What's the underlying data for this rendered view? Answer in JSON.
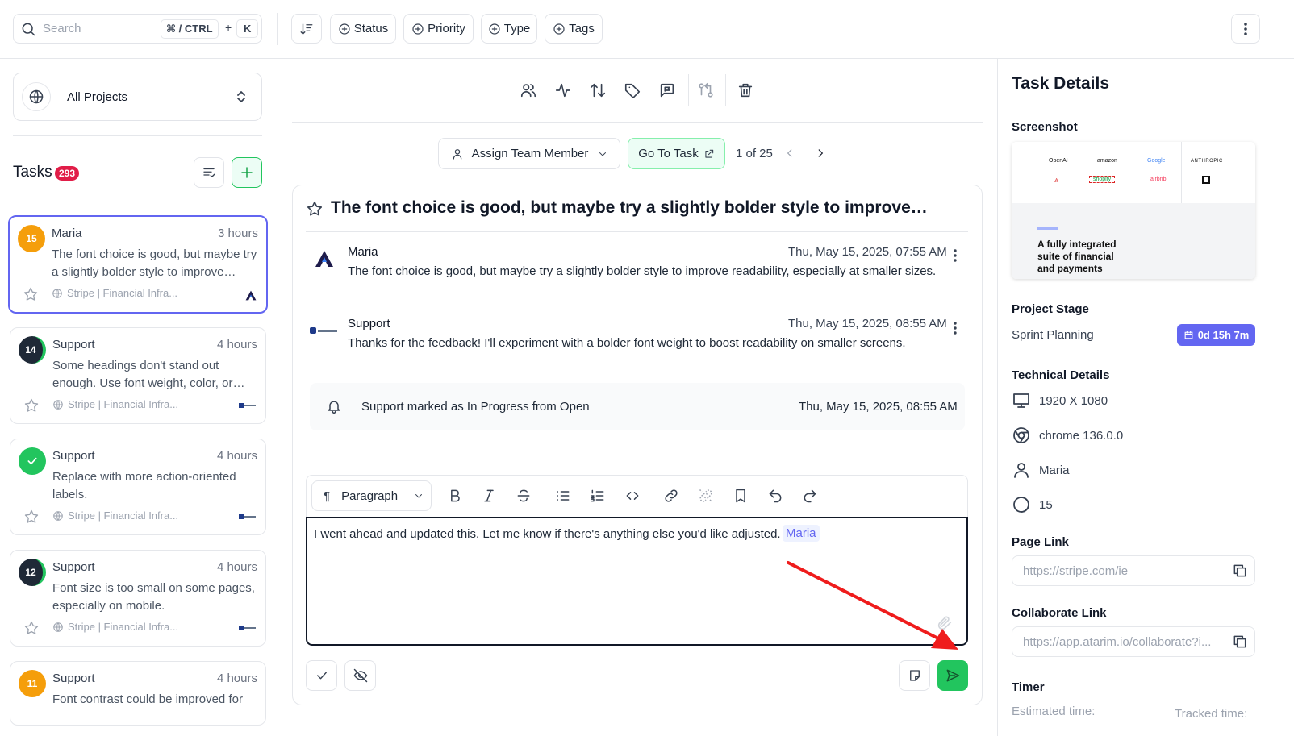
{
  "topbar": {
    "search_placeholder": "Search",
    "shortcut_mod": "⌘ / CTRL",
    "shortcut_plus": "+",
    "shortcut_key": "K",
    "filters": [
      "Status",
      "Priority",
      "Type",
      "Tags"
    ]
  },
  "sidebar": {
    "project_selector": "All Projects",
    "tasks_title": "Tasks",
    "tasks_count": "293",
    "cards": [
      {
        "number": "15",
        "name": "Maria",
        "time": "3 hours",
        "text": "The font choice is good, but maybe try a slightly bolder style to improve…",
        "project": "Stripe | Financial Infra...",
        "avatar_color": "#f59e0b"
      },
      {
        "number": "14",
        "name": "Support",
        "time": "4 hours",
        "text": "Some headings don't stand out enough. Use font weight, color, or…",
        "project": "Stripe | Financial Infra...",
        "avatar_color": "#1f2937"
      },
      {
        "number": "",
        "name": "Support",
        "time": "4 hours",
        "text": "Replace with more action-oriented labels.",
        "project": "Stripe | Financial Infra...",
        "avatar_color": "#22c55e"
      },
      {
        "number": "12",
        "name": "Support",
        "time": "4 hours",
        "text": "Font size is too small on some pages, especially on mobile.",
        "project": "Stripe | Financial Infra...",
        "avatar_color": "#1f2937"
      },
      {
        "number": "11",
        "name": "Support",
        "time": "4 hours",
        "text": "Font contrast could be improved for",
        "project": "",
        "avatar_color": "#f59e0b"
      }
    ]
  },
  "main": {
    "assign_label": "Assign Team Member",
    "goto_label": "Go To Task",
    "pager": "1 of 25",
    "task_title": "The font choice is good, but maybe try a slightly bolder style to improve…",
    "comments": [
      {
        "author": "Maria",
        "date": "Thu, May 15, 2025, 07:55 AM",
        "text": "The font choice is good, but maybe try a slightly bolder style to improve readability, especially at smaller sizes."
      },
      {
        "author": "Support",
        "date": "Thu, May 15, 2025, 08:55 AM",
        "text": "Thanks for the feedback! I'll experiment with a bolder font weight to boost readability on smaller screens."
      }
    ],
    "activity": {
      "text": "Support marked as In Progress from Open",
      "date": "Thu, May 15, 2025, 08:55 AM"
    },
    "editor": {
      "paragraph_label": "Paragraph",
      "text": "I went ahead and updated this. Let me know if there's anything else you'd like adjusted.",
      "mention": "Maria"
    }
  },
  "details": {
    "title": "Task Details",
    "screenshot_label": "Screenshot",
    "screenshot_caption": "A fully integrated suite of financial and payments",
    "screenshot_logos": [
      "OpenAI",
      "amazon",
      "Google",
      "ANTHROPIC",
      "shopify",
      "airbnb"
    ],
    "project_stage_label": "Project Stage",
    "project_stage_value": "Sprint Planning",
    "stage_badge": "0d 15h 7m",
    "technical_label": "Technical Details",
    "resolution": "1920 X 1080",
    "browser": "chrome 136.0.0",
    "user": "Maria",
    "task_number": "15",
    "page_link_label": "Page Link",
    "page_link": "https://stripe.com/ie",
    "collab_label": "Collaborate Link",
    "collab_link": "https://app.atarim.io/collaborate?i...",
    "timer_label": "Timer",
    "estimated_label": "Estimated time:",
    "tracked_label": "Tracked time:"
  },
  "colors": {
    "accent": "#6366f1",
    "green": "#22c55e",
    "badge": "#e11d48"
  }
}
